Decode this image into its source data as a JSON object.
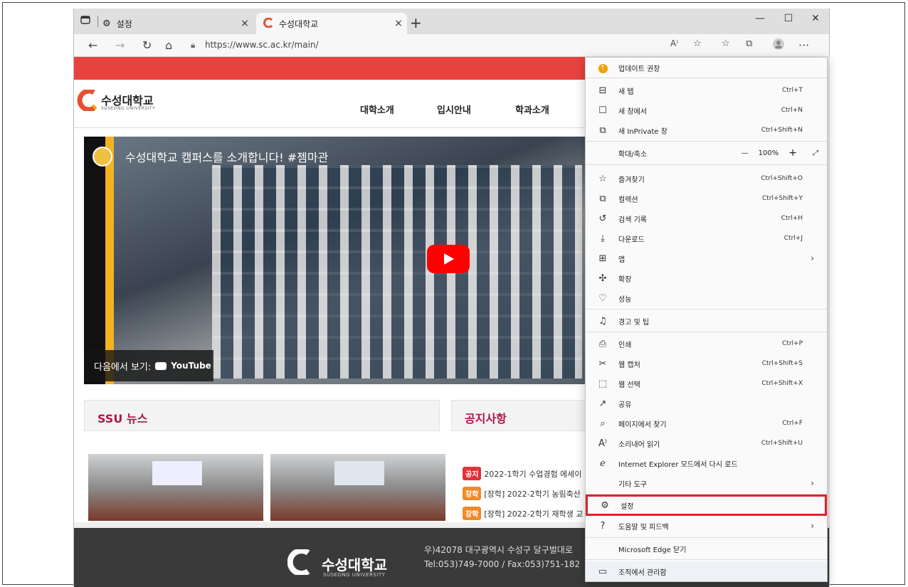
{
  "browser": {
    "tabs": [
      {
        "label": "설정",
        "close": "×"
      },
      {
        "label": "수성대학교",
        "close": "×"
      }
    ],
    "new_tab": "+",
    "window_controls": [
      "—",
      "☐",
      "✕"
    ],
    "url": "https://www.sc.ac.kr/main/"
  },
  "site": {
    "logo_name": "수성대학교",
    "logo_sub": "SUSEONG UNIVERSITY",
    "nav": [
      "대학소개",
      "입시안내",
      "학과소개"
    ],
    "video_title": "수성대학교 캠퍼스를 소개합니다! #젬마관",
    "watch_on": "다음에서 보기:",
    "youtube": "YouTube",
    "news_title": "SSU 뉴스",
    "notice_title": "공지사항",
    "notices": [
      {
        "badge": "공지",
        "text": "2022-1학기 수업경험 에세이",
        "color": "#e0323a"
      },
      {
        "badge": "장학",
        "text": "[장학] 2022-2학기 농림축산",
        "color": "#f08a28"
      },
      {
        "badge": "장학",
        "text": "[장학] 2022-2학기 재학생 교",
        "color": "#f08a28"
      }
    ],
    "footer_name": "수성대학교",
    "footer_sub": "SUSEONG UNIVERSITY",
    "footer_addr1": "우)42078 대구광역시 수성구 달구벌대로",
    "footer_addr2": "Tel:053)749-7000 / Fax:053)751-182"
  },
  "menu": {
    "items": [
      {
        "label": "업데이트 권장",
        "shortcut": "",
        "icon": "update-icon"
      },
      {
        "label": "새 탭",
        "shortcut": "Ctrl+T",
        "icon": "new-tab-icon"
      },
      {
        "label": "새 창에서",
        "shortcut": "Ctrl+N",
        "icon": "new-window-icon"
      },
      {
        "label": "새 InPrivate 창",
        "shortcut": "Ctrl+Shift+N",
        "icon": "inprivate-icon"
      },
      {
        "label": "확대/축소",
        "shortcut": "",
        "icon": ""
      },
      {
        "label": "즐겨찾기",
        "shortcut": "Ctrl+Shift+O",
        "icon": "favorites-icon"
      },
      {
        "label": "컬렉션",
        "shortcut": "Ctrl+Shift+Y",
        "icon": "collections-icon"
      },
      {
        "label": "검색 기록",
        "shortcut": "Ctrl+H",
        "icon": "history-icon"
      },
      {
        "label": "다운로드",
        "shortcut": "Ctrl+J",
        "icon": "download-icon"
      },
      {
        "label": "앱",
        "shortcut": "",
        "icon": "apps-icon"
      },
      {
        "label": "확장",
        "shortcut": "",
        "icon": "extensions-icon"
      },
      {
        "label": "성능",
        "shortcut": "",
        "icon": "performance-icon"
      },
      {
        "label": "경고 및 팁",
        "shortcut": "",
        "icon": "bell-icon"
      },
      {
        "label": "인쇄",
        "shortcut": "Ctrl+P",
        "icon": "print-icon"
      },
      {
        "label": "웹 캡처",
        "shortcut": "Ctrl+Shift+S",
        "icon": "web-capture-icon"
      },
      {
        "label": "웹 선택",
        "shortcut": "Ctrl+Shift+X",
        "icon": "web-select-icon"
      },
      {
        "label": "공유",
        "shortcut": "",
        "icon": "share-icon"
      },
      {
        "label": "페이지에서 찾기",
        "shortcut": "Ctrl+F",
        "icon": "find-icon"
      },
      {
        "label": "소리내어 읽기",
        "shortcut": "Ctrl+Shift+U",
        "icon": "read-aloud-icon"
      },
      {
        "label": "Internet Explorer 모드에서 다시 로드",
        "shortcut": "",
        "icon": "ie-icon"
      },
      {
        "label": "기타 도구",
        "shortcut": "",
        "icon": ""
      },
      {
        "label": "설정",
        "shortcut": "",
        "icon": "gear-icon"
      },
      {
        "label": "도움말 및 피드백",
        "shortcut": "",
        "icon": "help-icon"
      },
      {
        "label": "Microsoft Edge 닫기",
        "shortcut": "",
        "icon": ""
      },
      {
        "label": "조직에서 관리함",
        "shortcut": "",
        "icon": "briefcase-icon"
      }
    ],
    "zoom_value": "100%",
    "zoom_minus": "—",
    "zoom_plus": "+",
    "highlight_color": "#e0202a"
  }
}
